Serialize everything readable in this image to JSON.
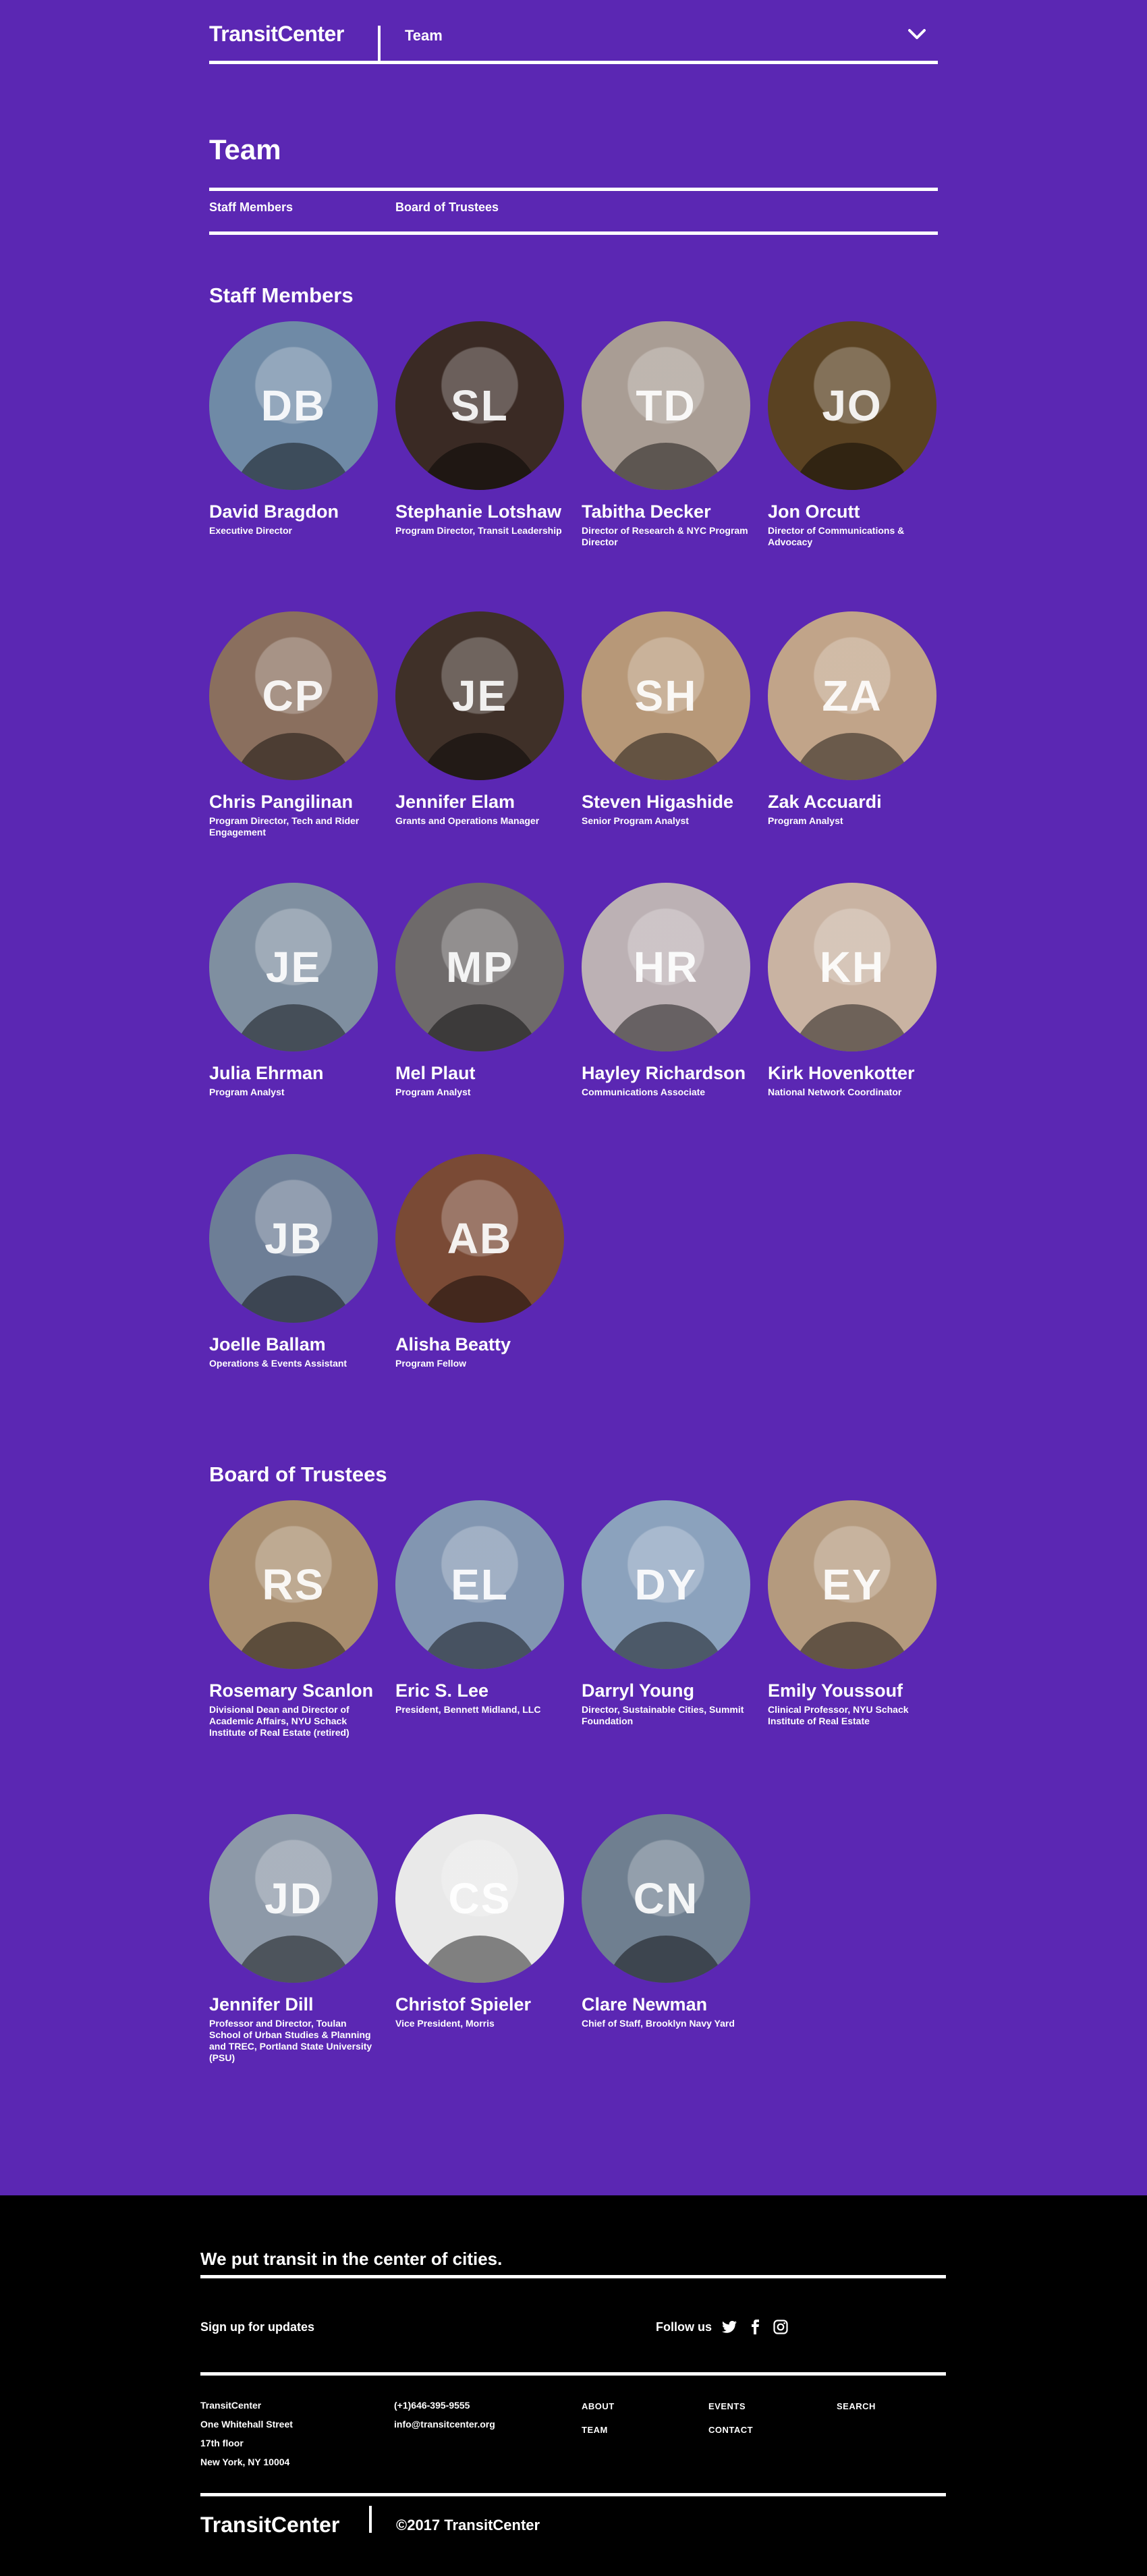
{
  "header": {
    "logo": "TransitCenter",
    "section": "Team"
  },
  "page": {
    "title": "Team",
    "subnav": [
      "Staff Members",
      "Board of Trustees"
    ]
  },
  "staff": {
    "title": "Staff Members",
    "people": [
      {
        "name": "David Bragdon",
        "title": "Executive Director",
        "initials": "DB",
        "photo_color": "#6f8aa6"
      },
      {
        "name": "Stephanie Lotshaw",
        "title": "Program Director, Transit Leadership",
        "initials": "SL",
        "photo_color": "#3a2a24"
      },
      {
        "name": "Tabitha Decker",
        "title": "Director of Research & NYC Program Director",
        "initials": "TD",
        "photo_color": "#a99d94"
      },
      {
        "name": "Jon Orcutt",
        "title": "Director of Communications & Advocacy",
        "initials": "JO",
        "photo_color": "#5a4222"
      },
      {
        "name": "Chris Pangilinan",
        "title": "Program Director, Tech and Rider Engagement",
        "initials": "CP",
        "photo_color": "#8a6f5e"
      },
      {
        "name": "Jennifer Elam",
        "title": "Grants and Operations Manager",
        "initials": "JE",
        "photo_color": "#3f3028"
      },
      {
        "name": "Steven Higashide",
        "title": "Senior Program Analyst",
        "initials": "SH",
        "photo_color": "#b79878"
      },
      {
        "name": "Zak Accuardi",
        "title": "Program Analyst",
        "initials": "ZA",
        "photo_color": "#c1a489"
      },
      {
        "name": "Julia Ehrman",
        "title": "Program Analyst",
        "initials": "JE",
        "photo_color": "#7f8fa0"
      },
      {
        "name": "Mel Plaut",
        "title": "Program Analyst",
        "initials": "MP",
        "photo_color": "#6e6a6a"
      },
      {
        "name": "Hayley Richardson",
        "title": "Communications Associate",
        "initials": "HR",
        "photo_color": "#bcb1b4"
      },
      {
        "name": "Kirk Hovenkotter",
        "title": "National Network Coordinator",
        "initials": "KH",
        "photo_color": "#c9b3a2"
      },
      {
        "name": "Joelle Ballam",
        "title": "Operations & Events Assistant",
        "initials": "JB",
        "photo_color": "#6d7e96"
      },
      {
        "name": "Alisha Beatty",
        "title": "Program Fellow",
        "initials": "AB",
        "photo_color": "#7a4a35"
      }
    ]
  },
  "board": {
    "title": "Board of Trustees",
    "people": [
      {
        "name": "Rosemary Scanlon",
        "title": "Divisional Dean and Director of Academic Affairs, NYU Schack Institute of Real Estate (retired)",
        "initials": "RS",
        "photo_color": "#a88d6e"
      },
      {
        "name": "Eric S. Lee",
        "title": "President, Bennett Midland, LLC",
        "initials": "EL",
        "photo_color": "#8296b1"
      },
      {
        "name": "Darryl Young",
        "title": "Director, Sustainable Cities, Summit Foundation",
        "initials": "DY",
        "photo_color": "#8ba2bd"
      },
      {
        "name": "Emily Youssouf",
        "title": "Clinical Professor, NYU Schack Institute of Real Estate",
        "initials": "EY",
        "photo_color": "#b49a7e"
      },
      {
        "name": "Jennifer Dill",
        "title": "Professor and Director, Toulan School of Urban Studies & Planning and TREC, Portland State University (PSU)",
        "initials": "JD",
        "photo_color": "#8d99a8"
      },
      {
        "name": "Christof Spieler",
        "title": "Vice President, Morris",
        "initials": "CS",
        "photo_color": "#e9e9e9"
      },
      {
        "name": "Clare Newman",
        "title": "Chief of Staff, Brooklyn Navy Yard",
        "initials": "CN",
        "photo_color": "#6f7f90"
      }
    ]
  },
  "footer": {
    "tagline": "We put transit in the center of cities.",
    "signup": "Sign up for updates",
    "follow": "Follow us",
    "social_icons": [
      "twitter-icon",
      "facebook-icon",
      "instagram-icon"
    ],
    "address": [
      "TransitCenter",
      "One Whitehall Street",
      "17th floor",
      "New York, NY 10004"
    ],
    "phone": "(+1)646-395-9555",
    "email": "info@transitcenter.org",
    "links": [
      "ABOUT",
      "EVENTS",
      "SEARCH",
      "TEAM",
      "CONTACT"
    ],
    "logo": "TransitCenter",
    "copyright": "©2017 TransitCenter"
  },
  "colors": {
    "brand_purple": "#5b27b3",
    "footer_black": "#000000",
    "text": "#ffffff"
  }
}
